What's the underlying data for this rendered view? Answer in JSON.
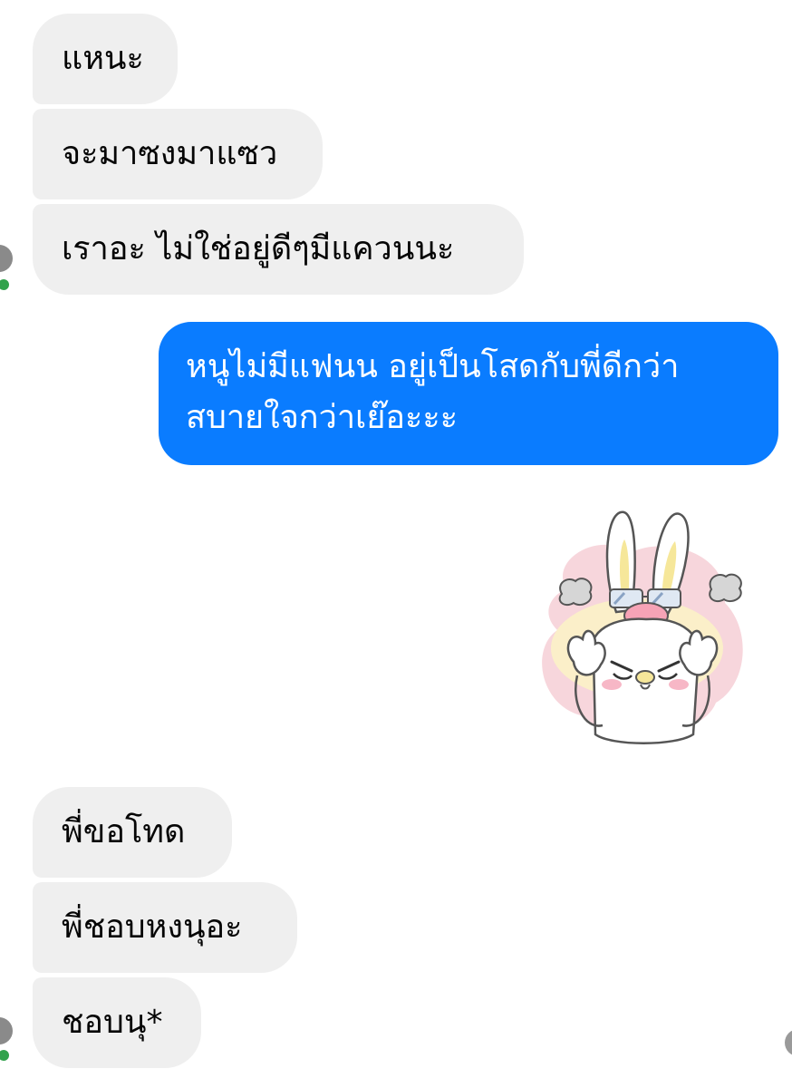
{
  "conversation": {
    "incoming_group_1": [
      {
        "text": "แหนะ"
      },
      {
        "text": "จะมาซงมาแซว"
      },
      {
        "text": "เราอะ ไม่ใช่อยู่ดีๆมีแควนนะ"
      }
    ],
    "outgoing": {
      "line1": "หนูไม่มีแฟนน อยู่เป็นโสดกับพี่ดีกว่า",
      "line2": "สบายใจกว่าเย๊อะะะ",
      "bubble_color": "#0a7cff"
    },
    "sticker": {
      "icon": "angry-bunny-sticker-icon"
    },
    "incoming_group_2": [
      {
        "text": "พี่ขอโทด"
      },
      {
        "text": "พี่ชอบหงนุอะ"
      },
      {
        "text": "ชอบนุ*"
      }
    ]
  },
  "colors": {
    "incoming_bubble": "#efefef",
    "online_indicator": "#31a24c"
  }
}
